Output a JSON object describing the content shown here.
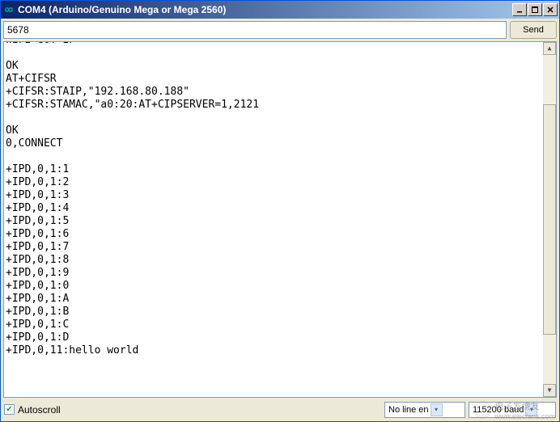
{
  "window": {
    "title": "COM4 (Arduino/Genuino Mega or Mega 2560)"
  },
  "input": {
    "value": "5678",
    "send_label": "Send"
  },
  "output_lines": [
    "WIFI GOT IP",
    "",
    "OK",
    "AT+CIFSR",
    "+CIFSR:STAIP,\"192.168.80.188\"",
    "+CIFSR:STAMAC,\"a0:20:AT+CIPSERVER=1,2121",
    "",
    "OK",
    "0,CONNECT",
    "",
    "+IPD,0,1:1",
    "+IPD,0,1:2",
    "+IPD,0,1:3",
    "+IPD,0,1:4",
    "+IPD,0,1:5",
    "+IPD,0,1:6",
    "+IPD,0,1:7",
    "+IPD,0,1:8",
    "+IPD,0,1:9",
    "+IPD,0,1:0",
    "+IPD,0,1:A",
    "+IPD,0,1:B",
    "+IPD,0,1:C",
    "+IPD,0,1:D",
    "+IPD,0,11:hello world"
  ],
  "footer": {
    "autoscroll_label": "Autoscroll",
    "autoscroll_checked": true,
    "line_ending": "No line en",
    "baud": "115200 baud"
  },
  "watermark": {
    "text": "电子发烧友",
    "url": "www.elecfans.com"
  }
}
